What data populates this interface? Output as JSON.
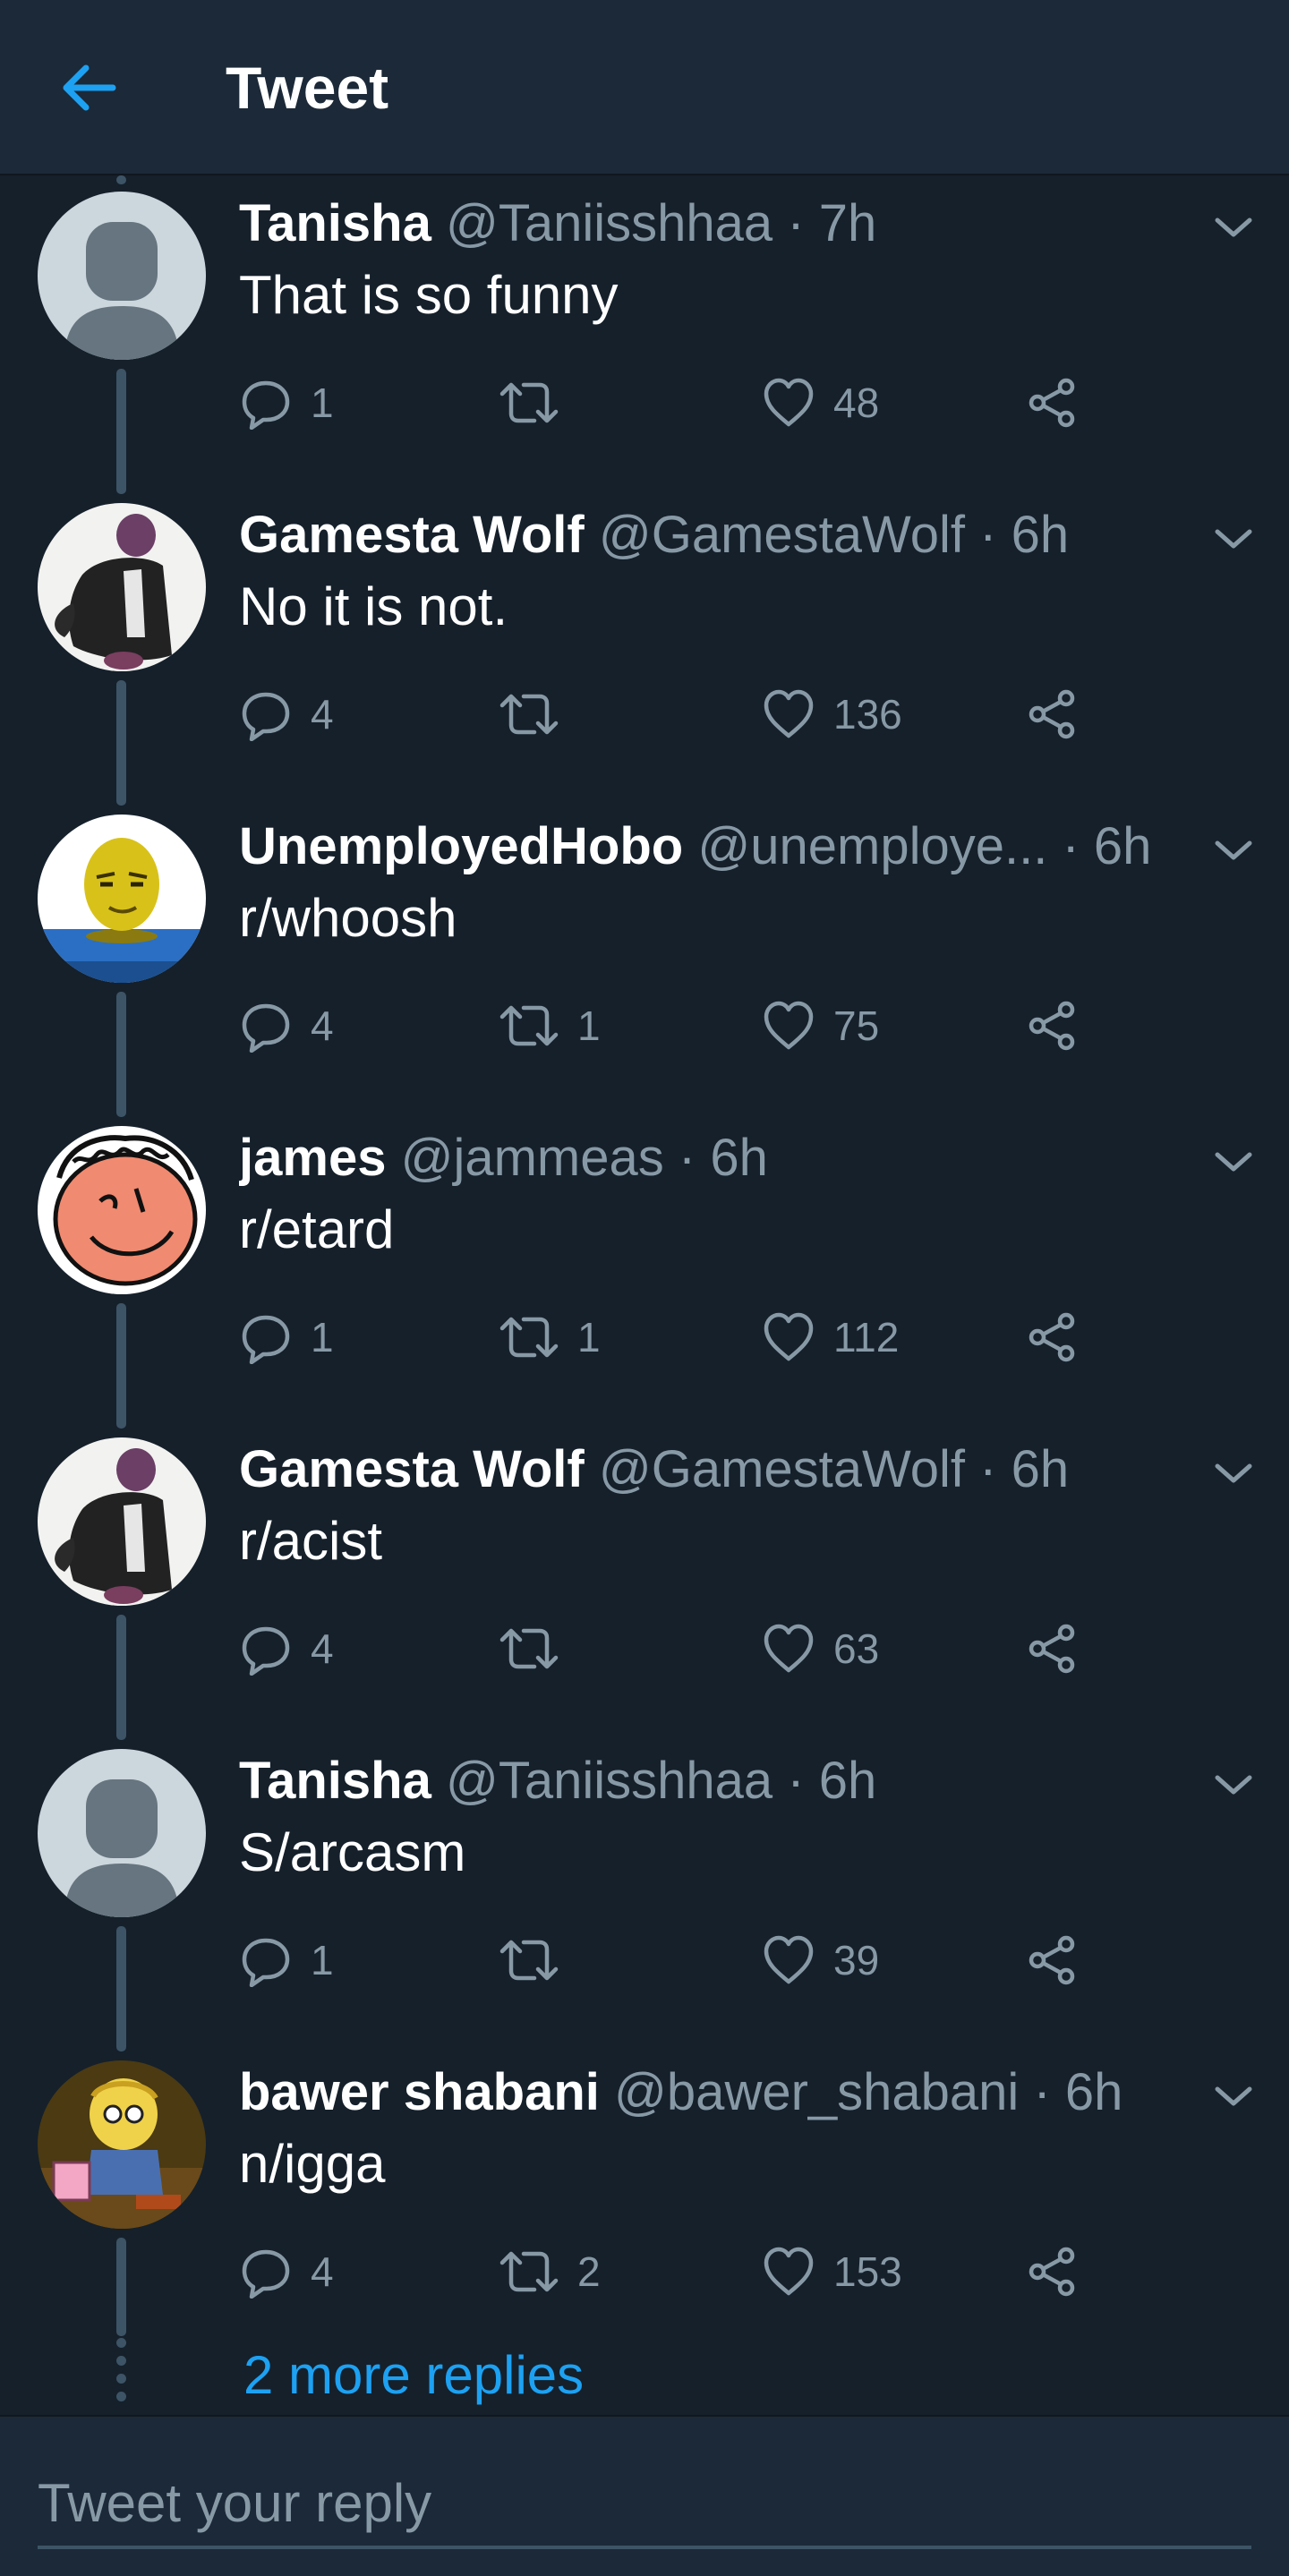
{
  "header": {
    "title": "Tweet",
    "back_icon": "arrow-left-icon",
    "accent_color": "#1da1f2"
  },
  "tweets": [
    {
      "name": "Tanisha",
      "handle": "@Taniisshhaa",
      "time": "7h",
      "text": "That is so funny",
      "replies": "1",
      "retweets": "",
      "likes": "48",
      "avatar": "default-profile-avatar"
    },
    {
      "name": "Gamesta Wolf",
      "handle": "@GamestaWolf",
      "time": "6h",
      "text": "No it is not.",
      "replies": "4",
      "retweets": "",
      "likes": "136",
      "avatar": "cloaked-figure-avatar"
    },
    {
      "name": "UnemployedHobo",
      "handle": "@unemploye...",
      "time": "6h",
      "text": "r/whoosh",
      "replies": "4",
      "retweets": "1",
      "likes": "75",
      "avatar": "yellow-head-avatar"
    },
    {
      "name": "james",
      "handle": "@jammeas",
      "time": "6h",
      "text": "r/etard",
      "replies": "1",
      "retweets": "1",
      "likes": "112",
      "avatar": "cartoon-boy-avatar"
    },
    {
      "name": "Gamesta Wolf",
      "handle": "@GamestaWolf",
      "time": "6h",
      "text": "r/acist",
      "replies": "4",
      "retweets": "",
      "likes": "63",
      "avatar": "cloaked-figure-avatar"
    },
    {
      "name": "Tanisha",
      "handle": "@Taniisshhaa",
      "time": "6h",
      "text": "S/arcasm",
      "replies": "1",
      "retweets": "",
      "likes": "39",
      "avatar": "default-profile-avatar"
    },
    {
      "name": "bawer shabani",
      "handle": "@bawer_shabani",
      "time": "6h",
      "text": "n/igga",
      "replies": "4",
      "retweets": "2",
      "likes": "153",
      "avatar": "cartoon-kid-avatar"
    }
  ],
  "separator": "·",
  "more_replies": "2 more replies",
  "reply_box": {
    "placeholder": "Tweet your reply"
  },
  "icons": {
    "reply": "reply-icon",
    "retweet": "retweet-icon",
    "like": "heart-icon",
    "share": "share-icon",
    "caret": "chevron-down-icon"
  },
  "colors": {
    "background": "#15202b",
    "header_bg": "#1c2938",
    "muted_text": "#8899a6",
    "thread_line": "#3d5466",
    "link": "#1da1f2"
  }
}
